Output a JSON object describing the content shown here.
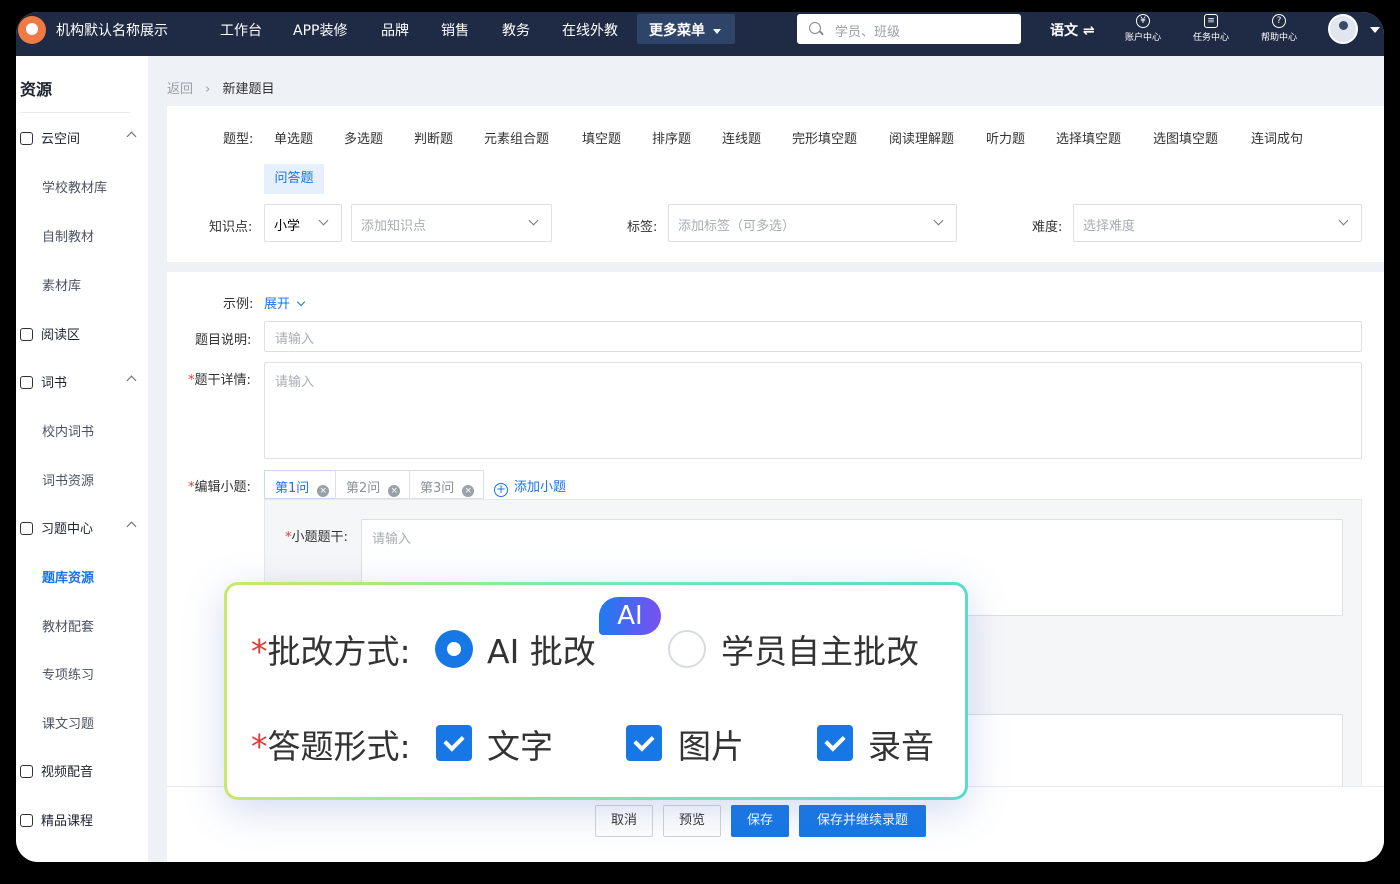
{
  "header": {
    "brand": "机构默认名称展示",
    "nav": [
      "工作台",
      "APP装修",
      "品牌",
      "销售",
      "教务",
      "在线外教"
    ],
    "more_menu": "更多菜单",
    "search_placeholder": "学员、班级",
    "language": "语文 ⇌",
    "tools": [
      {
        "icon": "¥",
        "label": "账户中心"
      },
      {
        "icon": "≡",
        "label": "任务中心"
      },
      {
        "icon": "?",
        "label": "帮助中心"
      }
    ]
  },
  "sidebar": {
    "title": "资源",
    "groups": [
      {
        "label": "云空间",
        "children": [
          "学校教材库",
          "自制教材",
          "素材库"
        ]
      },
      {
        "label": "阅读区",
        "children": []
      },
      {
        "label": "词书",
        "children": [
          "校内词书",
          "词书资源"
        ]
      },
      {
        "label": "习题中心",
        "children": [
          "题库资源",
          "教材配套",
          "专项练习",
          "课文习题"
        ]
      },
      {
        "label": "视频配音",
        "children": []
      },
      {
        "label": "精品课程",
        "children": []
      }
    ],
    "active_item": "题库资源"
  },
  "breadcrumb": {
    "back": "返回",
    "separator": "›",
    "current": "新建题目"
  },
  "form": {
    "type_label": "题型:",
    "types": [
      "单选题",
      "多选题",
      "判断题",
      "元素组合题",
      "填空题",
      "排序题",
      "连线题",
      "完形填空题",
      "阅读理解题",
      "听力题",
      "选择填空题",
      "选图填空题",
      "连词成句"
    ],
    "active_type": "问答题",
    "knowledge_label": "知识点:",
    "knowledge_level": "小学",
    "knowledge_placeholder": "添加知识点",
    "tag_label": "标签:",
    "tag_placeholder": "添加标签（可多选）",
    "difficulty_label": "难度:",
    "difficulty_placeholder": "选择难度",
    "example_label": "示例:",
    "example_toggle": "展开",
    "desc_label": "题目说明:",
    "desc_placeholder": "请输入",
    "stem_label": "题干详情:",
    "stem_placeholder": "请输入",
    "subq_label": "编辑小题:",
    "subq_tabs": [
      "第1问",
      "第2问",
      "第3问"
    ],
    "add_subq": "添加小题",
    "subq_stem_label": "小题题干:",
    "subq_stem_placeholder": "请输入"
  },
  "footer": {
    "cancel": "取消",
    "preview": "预览",
    "save": "保存",
    "save_continue": "保存并继续录题"
  },
  "popup": {
    "grading_label": "批改方式:",
    "grading_options": [
      "AI 批改",
      "学员自主批改"
    ],
    "ai_badge": "AI",
    "answer_label": "答题形式:",
    "answer_options": [
      "文字",
      "图片",
      "录音"
    ]
  },
  "colors": {
    "accent": "#1677e5",
    "topbar": "#1f2b44",
    "required": "#e53935"
  }
}
